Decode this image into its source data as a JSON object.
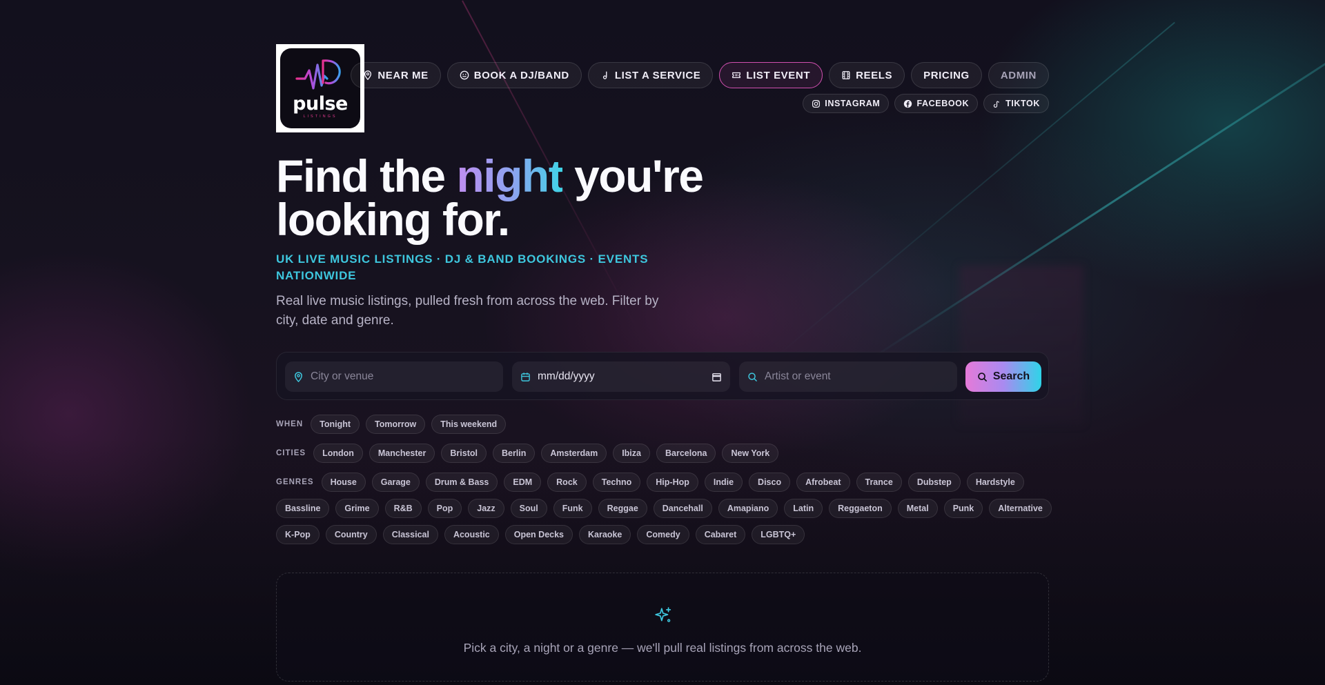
{
  "brand": {
    "name": "pulse",
    "sub": "LISTINGS"
  },
  "nav": {
    "near_me": "NEAR ME",
    "book": "BOOK A DJ/BAND",
    "list_service": "LIST A SERVICE",
    "list_event": "LIST EVENT",
    "reels": "REELS",
    "pricing": "PRICING",
    "admin": "ADMIN"
  },
  "social": {
    "instagram": "INSTAGRAM",
    "facebook": "FACEBOOK",
    "tiktok": "TIKTOK"
  },
  "hero": {
    "headline_pre": "Find the ",
    "headline_accent": "night",
    "headline_post": " you're looking for.",
    "tagline": "UK LIVE MUSIC LISTINGS · DJ & BAND BOOKINGS · EVENTS NATIONWIDE",
    "description": "Real live music listings, pulled fresh from across the web. Filter by city, date and genre."
  },
  "search": {
    "city_placeholder": "City or venue",
    "date_value": "mm/dd/yyyy",
    "artist_placeholder": "Artist or event",
    "button": "Search"
  },
  "filters": {
    "when_label": "WHEN",
    "when": [
      "Tonight",
      "Tomorrow",
      "This weekend"
    ],
    "cities_label": "CITIES",
    "cities": [
      "London",
      "Manchester",
      "Bristol",
      "Berlin",
      "Amsterdam",
      "Ibiza",
      "Barcelona",
      "New York"
    ],
    "genres_label": "GENRES",
    "genres_row1": [
      "House",
      "Garage",
      "Drum & Bass",
      "EDM",
      "Rock",
      "Techno",
      "Hip-Hop",
      "Indie",
      "Disco",
      "Afrobeat",
      "Trance",
      "Dubstep",
      "Hardstyle"
    ],
    "genres_row2": [
      "Bassline",
      "Grime",
      "R&B",
      "Pop",
      "Jazz",
      "Soul",
      "Funk",
      "Reggae",
      "Dancehall",
      "Amapiano",
      "Latin",
      "Reggaeton",
      "Metal",
      "Punk",
      "Alternative"
    ],
    "genres_row3": [
      "K-Pop",
      "Country",
      "Classical",
      "Acoustic",
      "Open Decks",
      "Karaoke",
      "Comedy",
      "Cabaret",
      "LGBTQ+"
    ]
  },
  "empty_state": {
    "icon": "sparkles-icon",
    "text": "Pick a city, a night or a genre — we'll pull real listings from across the web."
  },
  "colors": {
    "accent_cyan": "#3ec7de",
    "accent_pink": "#d14fb0",
    "background": "#0f0d1a"
  }
}
